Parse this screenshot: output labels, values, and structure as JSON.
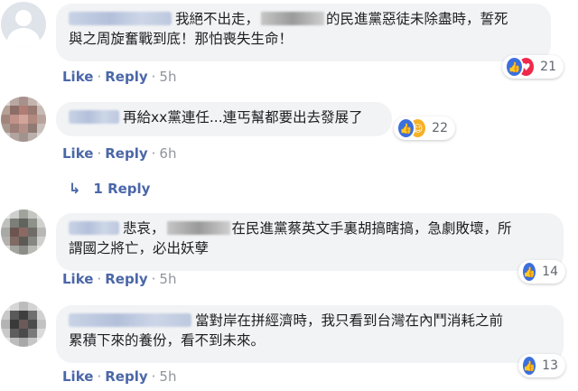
{
  "comments": [
    {
      "text_a": "我絕不出走，",
      "text_b": "的民進黨惡徒未除盡時，誓死",
      "text_c": "與之周旋奮戰到底！那怕喪失生命！",
      "reaction_count": "21",
      "reactions": [
        "like-icon",
        "love-icon"
      ],
      "like": "Like",
      "reply": "Reply",
      "time": "5h"
    },
    {
      "text_a": "再給xx黨連任...連丐幫都要出去發展了",
      "reaction_count": "22",
      "reactions": [
        "like-icon",
        "haha-icon"
      ],
      "like": "Like",
      "reply": "Reply",
      "time": "6h",
      "replies_link": "1 Reply"
    },
    {
      "text_a": "悲哀，",
      "text_b": "在民進黨蔡英文手裏胡搞瞎搞，急劇敗壞，所",
      "text_c": "謂國之將亡，必出妖孽",
      "reaction_count": "14",
      "reactions": [
        "like-icon"
      ],
      "like": "Like",
      "reply": "Reply",
      "time": "5h"
    },
    {
      "text_a": "當對岸在拼經濟時，我只看到台灣在內鬥消耗之前",
      "text_c": "累積下來的養份，看不到未來。",
      "reaction_count": "13",
      "reactions": [
        "like-icon"
      ],
      "like": "Like",
      "reply": "Reply",
      "time": "5h"
    }
  ],
  "separator": "·",
  "colors": {
    "link": "#4b67a8",
    "bubble": "#f2f3f5",
    "meta": "#90949c"
  }
}
